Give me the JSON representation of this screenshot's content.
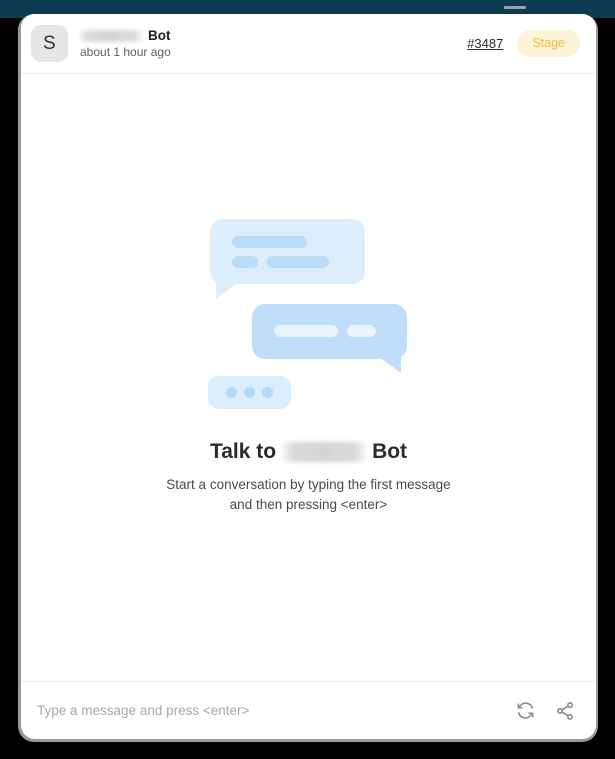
{
  "window": {
    "background_color": "#000000",
    "top_band_color": "#0c3b52",
    "card_background": "#ffffff"
  },
  "header": {
    "avatar_initial": "S",
    "bot_name_redacted": "",
    "bot_suffix": "Bot",
    "timestamp": "about 1 hour ago",
    "ticket_link": "#3487",
    "badge_label": "Stage",
    "badge_bg_color": "#fdf4d8",
    "badge_text_color": "#efc041"
  },
  "empty_state": {
    "headline_prefix": "Talk to",
    "headline_name_redacted": "",
    "headline_suffix": "Bot",
    "description_line1": "Start a conversation by typing the first message",
    "description_line2": "and then pressing <enter>",
    "illustration": {
      "bubble_light_color": "#dceefb",
      "bubble_medium_color": "#bfdefa",
      "bar_color": "#b9dcf7",
      "bar_light_color": "#e8f3fd",
      "dot_color": "#b3d9f6",
      "dot_count": 3
    }
  },
  "composer": {
    "placeholder": "Type a message and press <enter>",
    "value": "",
    "refresh_icon": "refresh-icon",
    "share_icon": "share-icon"
  }
}
